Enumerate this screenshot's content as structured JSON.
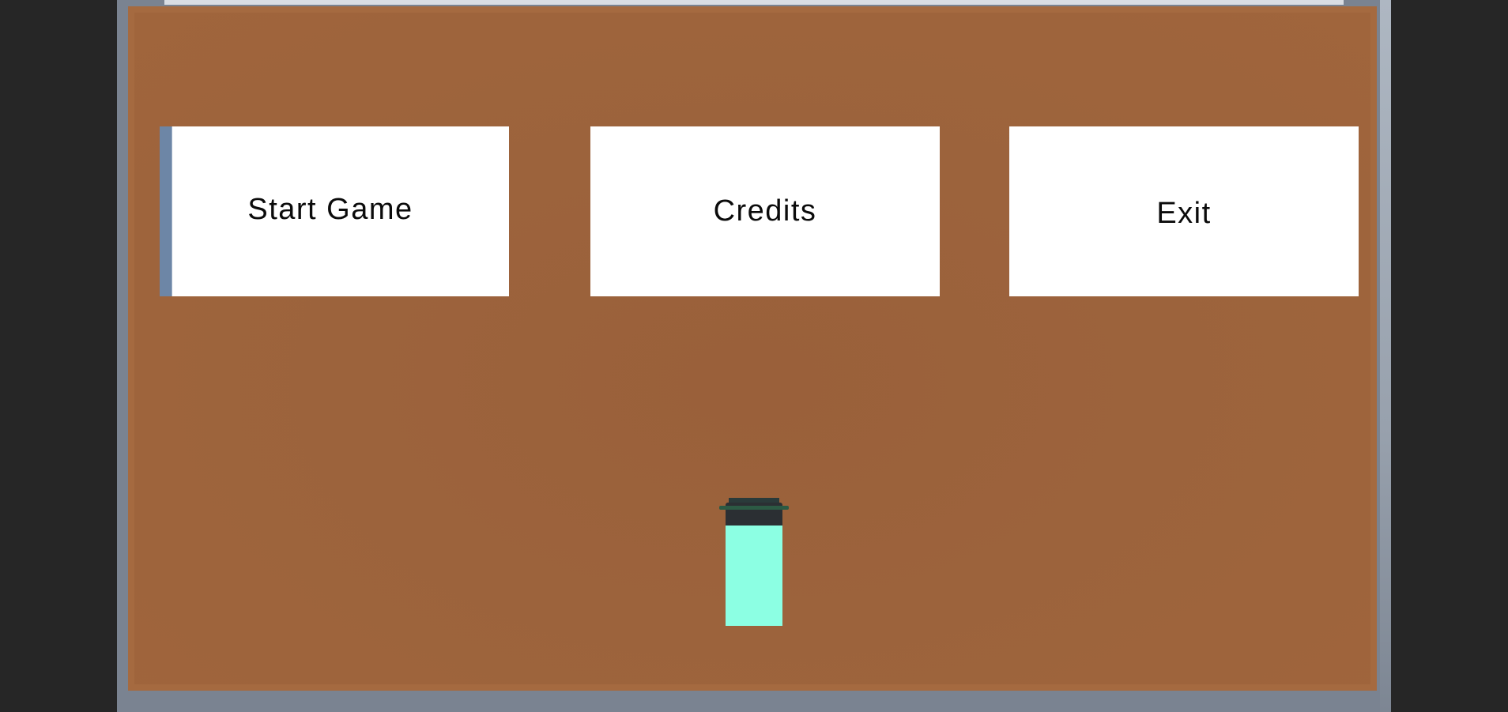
{
  "menu": {
    "start_label": "Start Game",
    "credits_label": "Credits",
    "exit_label": "Exit"
  },
  "colors": {
    "floor": "#9c633c",
    "button_bg": "#ffffff",
    "button_text": "#0b0b0b",
    "player_body": "#8cffe3",
    "player_head": "#2b2f33",
    "background": "#262626"
  }
}
